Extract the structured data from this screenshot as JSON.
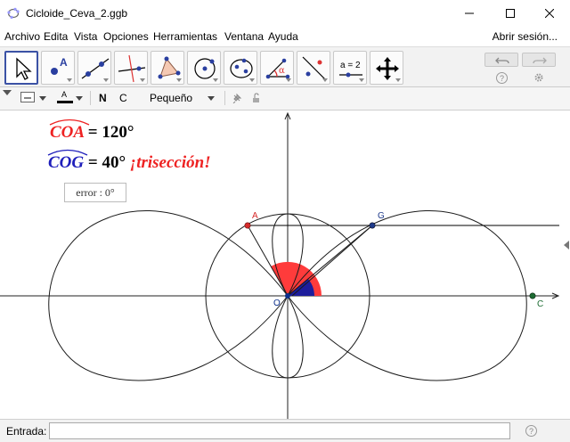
{
  "window": {
    "title": "Cicloide_Ceva_2.ggb"
  },
  "menu": {
    "items": [
      "Archivo",
      "Edita",
      "Vista",
      "Opciones",
      "Herramientas",
      "Ventana",
      "Ayuda"
    ],
    "signin": "Abrir sesión..."
  },
  "toolbar": {
    "tool_icons": [
      "move-icon",
      "point-icon",
      "line-icon",
      "perpendicular-icon",
      "polygon-icon",
      "circle-icon",
      "ellipse-icon",
      "angle-icon",
      "reflect-icon",
      "slider-icon",
      "move-view-icon"
    ],
    "slider_tool_text": "a = 2"
  },
  "stylebar": {
    "color_letter": "A",
    "bold": "N",
    "italic": "C",
    "size": "Pequeño"
  },
  "graphics": {
    "label_coa": {
      "arc": "COA",
      "value": "= 120°"
    },
    "label_cog": {
      "arc": "COG",
      "value": "= 40°",
      "note": "¡trisección!"
    },
    "error": "error :  0°",
    "points": {
      "A": "A",
      "G": "G",
      "O": "O",
      "C": "C"
    },
    "colors": {
      "red": "#ee2222",
      "blue": "#1f1fbb",
      "point_A": "#d62b2b",
      "point_G": "#1e3a8a",
      "point_O": "#0b2e8a",
      "point_C": "#1d6b33",
      "angle_red": "#ff3b3b",
      "angle_blue": "#1d1d9c"
    }
  },
  "inputbar": {
    "label": "Entrada:",
    "value": "",
    "placeholder": ""
  }
}
